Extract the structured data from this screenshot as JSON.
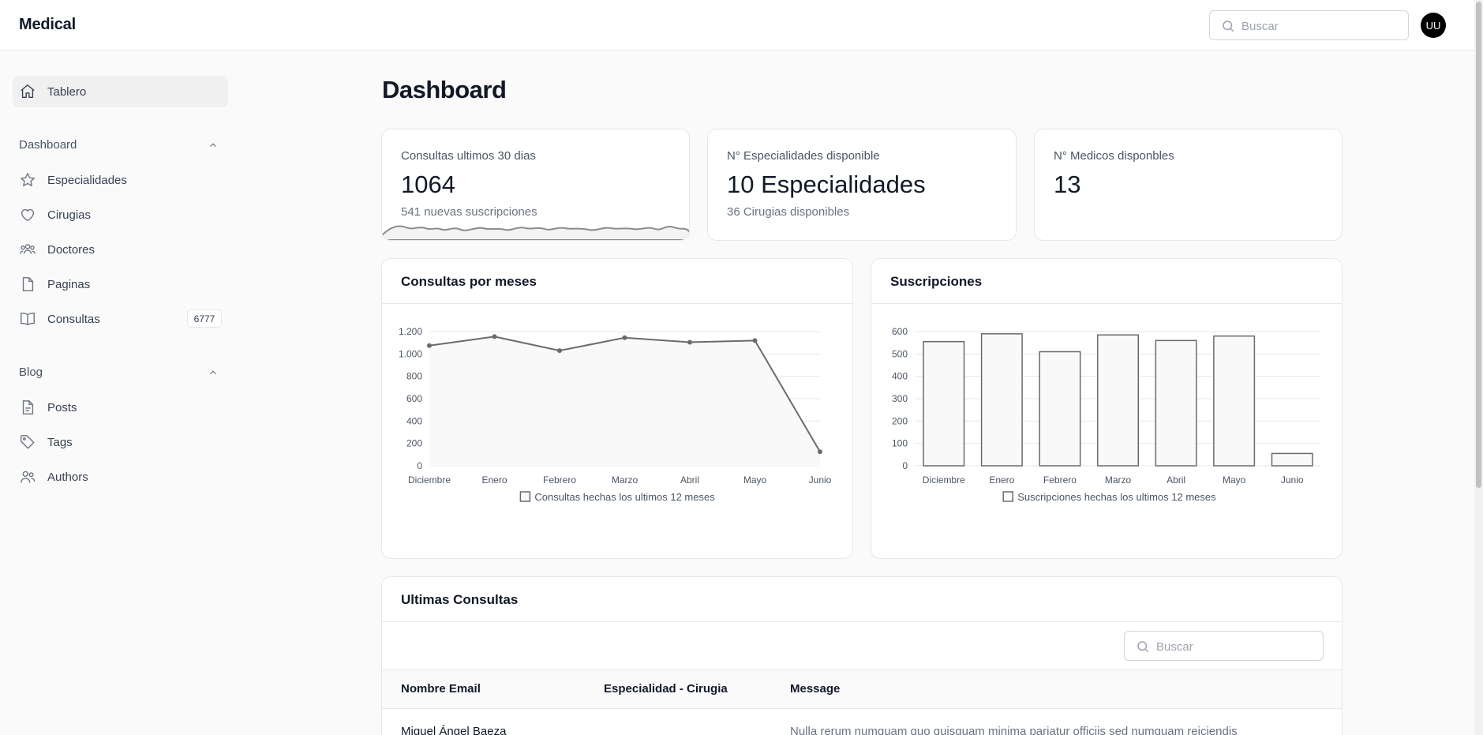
{
  "app": {
    "brand": "Medical",
    "avatar_initials": "UU"
  },
  "search": {
    "placeholder": "Buscar"
  },
  "sidebar": {
    "top": {
      "label": "Tablero",
      "icon": "home-icon"
    },
    "groups": [
      {
        "label": "Dashboard",
        "items": [
          {
            "label": "Especialidades",
            "icon": "star-icon"
          },
          {
            "label": "Cirugias",
            "icon": "heart-icon"
          },
          {
            "label": "Doctores",
            "icon": "users-group-icon"
          },
          {
            "label": "Paginas",
            "icon": "document-icon"
          },
          {
            "label": "Consultas",
            "icon": "book-open-icon",
            "badge": "6777"
          }
        ]
      },
      {
        "label": "Blog",
        "items": [
          {
            "label": "Posts",
            "icon": "document-text-icon"
          },
          {
            "label": "Tags",
            "icon": "tag-icon"
          },
          {
            "label": "Authors",
            "icon": "users-icon"
          }
        ]
      }
    ]
  },
  "page": {
    "title": "Dashboard"
  },
  "stats": [
    {
      "label": "Consultas ultimos 30 dias",
      "value": "1064",
      "sub": "541 nuevas suscripciones"
    },
    {
      "label": "N° Especialidades disponible",
      "value": "10 Especialidades",
      "sub": "36 Cirugias disponibles"
    },
    {
      "label": "N° Medicos disponbles",
      "value": "13",
      "sub": ""
    }
  ],
  "charts": {
    "consultas": {
      "title": "Consultas por meses"
    },
    "suscripciones": {
      "title": "Suscripciones"
    }
  },
  "chart_data": [
    {
      "type": "line",
      "title": "Consultas por meses",
      "categories": [
        "Diciembre",
        "Enero",
        "Febrero",
        "Marzo",
        "Abril",
        "Mayo",
        "Junio"
      ],
      "series": [
        {
          "name": "Consultas hechas los ultimos 12 meses",
          "values": [
            1075,
            1155,
            1030,
            1145,
            1105,
            1120,
            125
          ]
        }
      ],
      "ylim": [
        0,
        1200
      ],
      "yticks": [
        "0",
        "200",
        "400",
        "600",
        "800",
        "1.000",
        "1.200"
      ],
      "ytick_values": [
        0,
        200,
        400,
        600,
        800,
        1000,
        1200
      ],
      "grid": true,
      "legend": "bottom"
    },
    {
      "type": "bar",
      "title": "Suscripciones",
      "categories": [
        "Diciembre",
        "Enero",
        "Febrero",
        "Marzo",
        "Abril",
        "Mayo",
        "Junio"
      ],
      "series": [
        {
          "name": "Suscripciones hechas los ultimos 12 meses",
          "values": [
            555,
            590,
            510,
            585,
            560,
            580,
            55
          ]
        }
      ],
      "ylim": [
        0,
        600
      ],
      "yticks": [
        "0",
        "100",
        "200",
        "300",
        "400",
        "500",
        "600"
      ],
      "ytick_values": [
        0,
        100,
        200,
        300,
        400,
        500,
        600
      ],
      "grid": true,
      "legend": "bottom"
    }
  ],
  "table": {
    "title": "Ultimas Consultas",
    "search_placeholder": "Buscar",
    "columns": [
      "Nombre Email",
      "Especialidad - Cirugia",
      "Message"
    ],
    "rows": [
      [
        "Miguel Ángel Baeza",
        "",
        "Nulla rerum numquam quo quisquam minima pariatur officiis sed numquam reiciendis"
      ]
    ]
  },
  "colors": {
    "accent": "#000000",
    "chart_stroke": "#6b6b6b",
    "chart_fill": "#f9f9f9"
  }
}
